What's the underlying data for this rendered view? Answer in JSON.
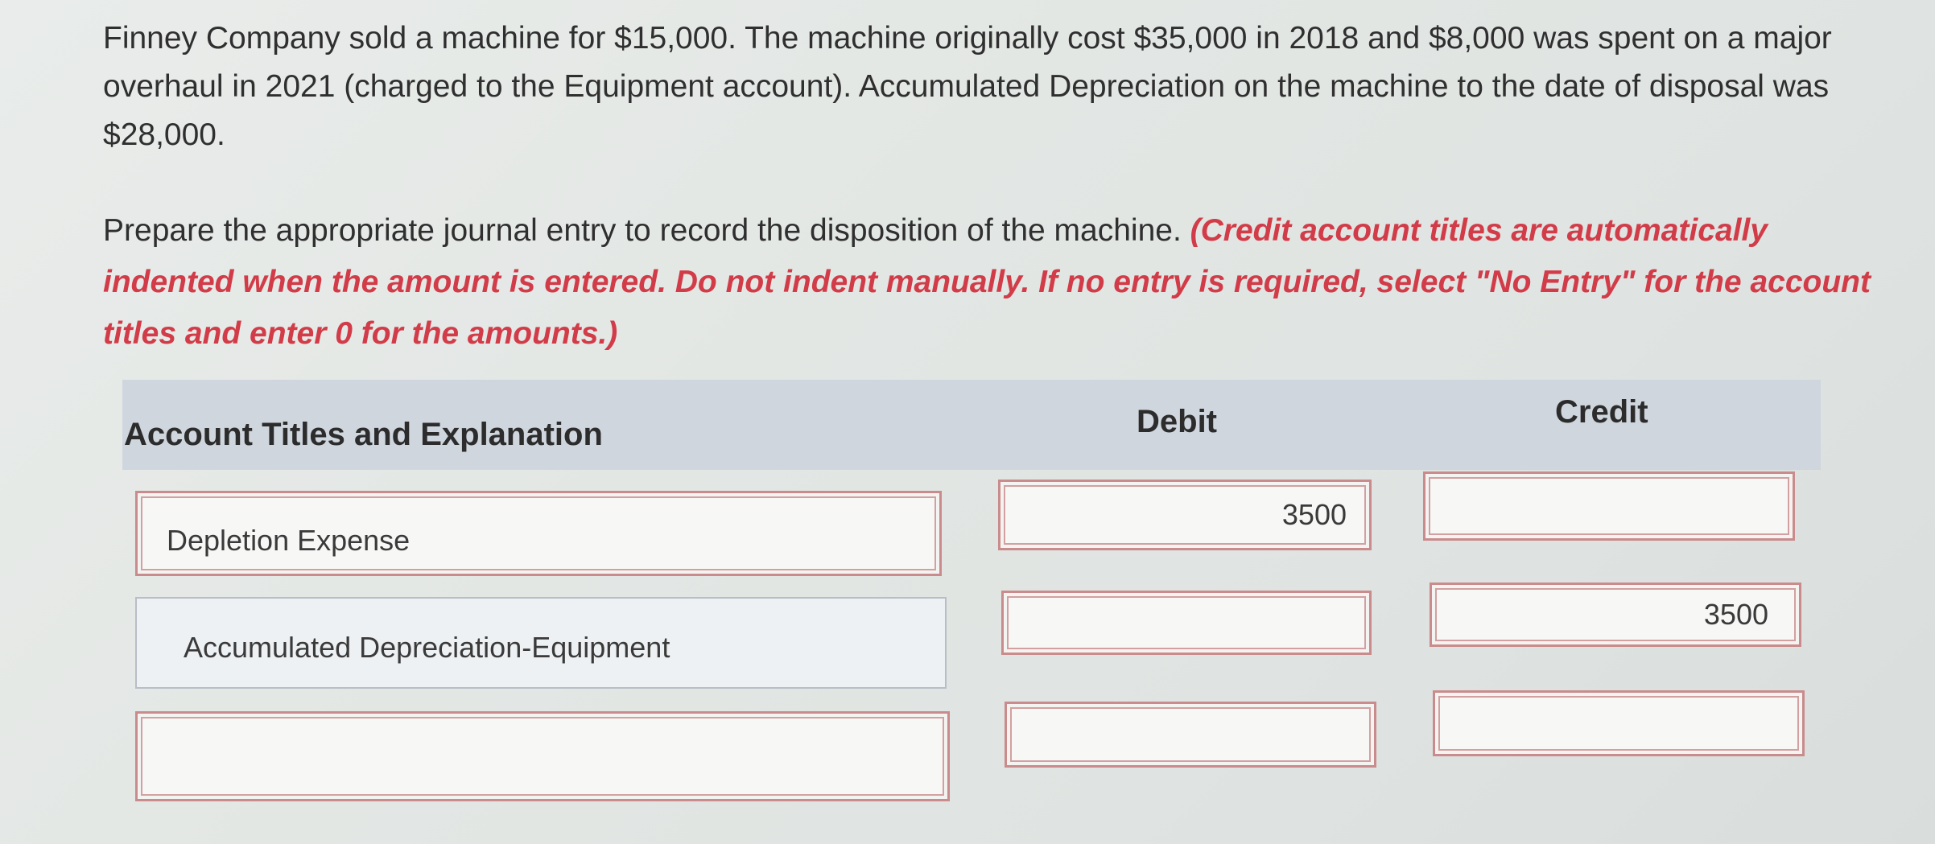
{
  "problem": {
    "text": "Finney Company sold a machine for $15,000. The machine originally cost $35,000 in 2018 and $8,000 was spent on a major overhaul in 2021 (charged to the Equipment account). Accumulated Depreciation on the machine to the date of disposal was $28,000."
  },
  "instruction": {
    "text": "Prepare the appropriate journal entry to record the disposition of the machine. ",
    "note": "(Credit account titles are automatically indented when the amount is entered. Do not indent manually. If no entry is required, select \"No Entry\" for the account titles and enter 0 for the amounts.)"
  },
  "table": {
    "headers": {
      "account": "Account Titles and Explanation",
      "debit": "Debit",
      "credit": "Credit"
    },
    "rows": [
      {
        "account": "Depletion Expense",
        "debit": "3500",
        "credit": ""
      },
      {
        "account": "Accumulated Depreciation-Equipment",
        "debit": "",
        "credit": "3500"
      },
      {
        "account": "",
        "debit": "",
        "credit": ""
      }
    ]
  },
  "colors": {
    "note_red": "#d23b48",
    "header_bg": "#cfd6de",
    "field_border": "#c98b8b"
  }
}
